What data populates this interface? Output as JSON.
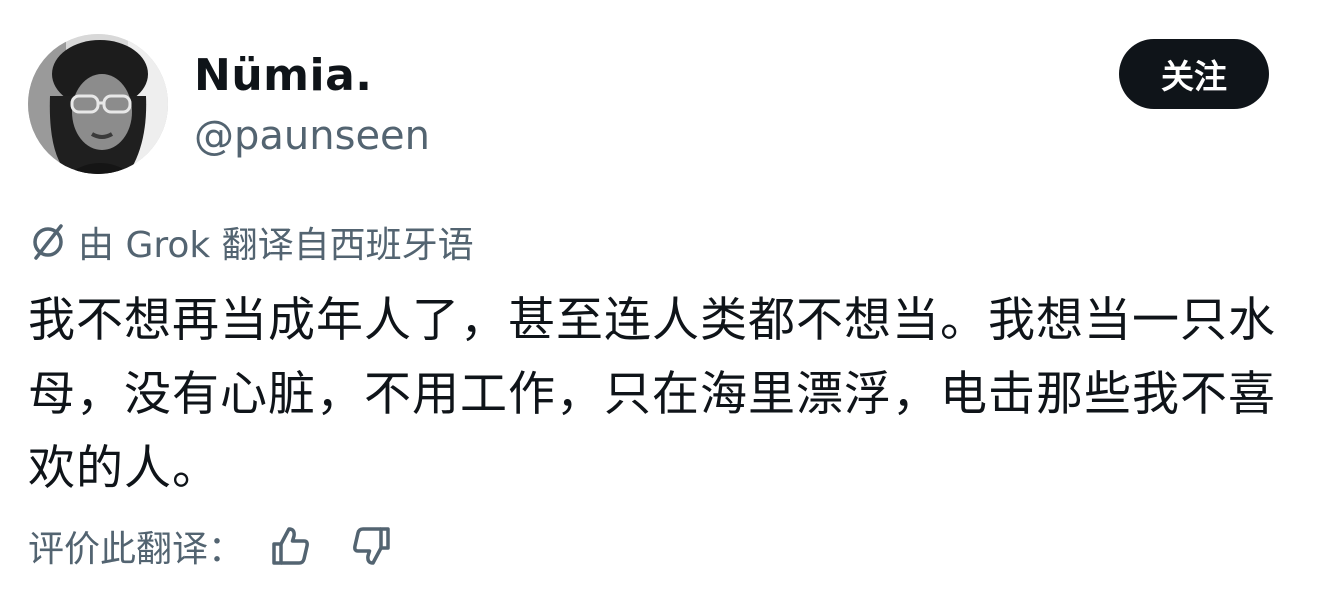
{
  "author": {
    "display_name": "Nümia.",
    "handle": "@paunseen",
    "avatar_icon": "user-avatar-photo"
  },
  "follow_button": {
    "label": "关注"
  },
  "translation": {
    "icon": "grok-icon",
    "label": "由 Grok 翻译自西班牙语"
  },
  "post": {
    "text": "我不想再当成年人了，甚至连人类都不想当。我想当一只水母，没有心脏，不用工作，只在海里漂浮，电击那些我不喜欢的人。"
  },
  "rating": {
    "label": "评价此翻译：",
    "thumbs_up_icon": "thumbs-up-icon",
    "thumbs_down_icon": "thumbs-down-icon"
  },
  "colors": {
    "text_primary": "#0f1419",
    "text_secondary": "#536471",
    "button_bg": "#0f1419",
    "button_text": "#ffffff"
  }
}
